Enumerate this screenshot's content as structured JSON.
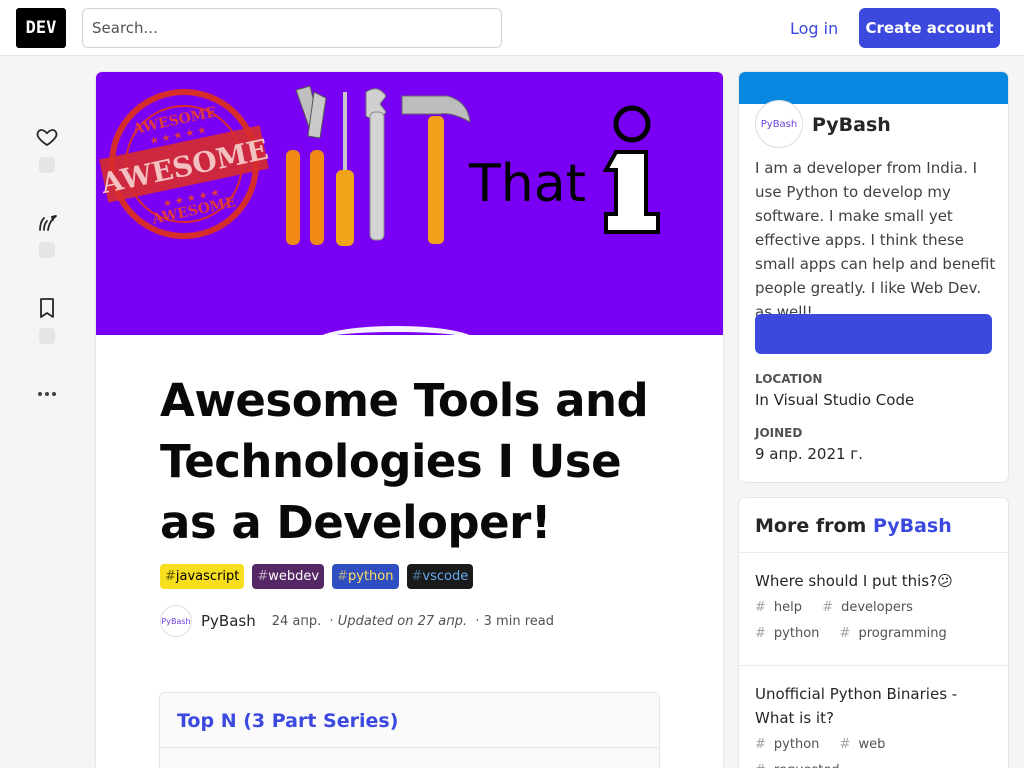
{
  "header": {
    "logo_text": "DEV",
    "search_placeholder": "Search...",
    "login_label": "Log in",
    "create_account_label": "Create account",
    "accent_color": "#3b49df"
  },
  "rail": {
    "items": [
      {
        "icon": "heart-icon"
      },
      {
        "icon": "unicorn-icon"
      },
      {
        "icon": "bookmark-icon"
      },
      {
        "icon": "more-dots-icon"
      }
    ]
  },
  "article": {
    "cover": {
      "background_color": "#7a00f5",
      "badge_text_top": "AWESOME",
      "badge_text_center": "AWESOME",
      "badge_text_bottom": "AWESOME",
      "word": "That"
    },
    "title": "Awesome Tools and Technologies I Use as a Developer!",
    "tags": [
      {
        "hash": "#",
        "name": "javascript",
        "bg": "#f7df1e",
        "fg": "#000000"
      },
      {
        "hash": "#",
        "name": "webdev",
        "bg": "#562765",
        "fg": "#ffffff"
      },
      {
        "hash": "#",
        "name": "python",
        "bg": "#2f4ec2",
        "fg": "#ffdf5b"
      },
      {
        "hash": "#",
        "name": "vscode",
        "bg": "#1a1a1a",
        "fg": "#65aaf0"
      }
    ],
    "author": {
      "avatar_text": "PyBash",
      "name": "PyBash",
      "date": "24 апр.",
      "updated": "Updated on 27 апр.",
      "read_time": "3 min read"
    },
    "series": {
      "title": "Top N (3 Part Series)"
    }
  },
  "profile": {
    "avatar_text": "PyBash",
    "name": "PyBash",
    "bio": "I am a developer from India. I use Python to develop my software. I make small yet effective apps. I think these small apps can help and benefit people greatly. I like Web Dev. as well!",
    "location_label": "LOCATION",
    "location_value": "In Visual Studio Code",
    "joined_label": "JOINED",
    "joined_value": "9 апр. 2021 г.",
    "band_color": "#0888e0"
  },
  "more_from": {
    "heading_prefix": "More from",
    "heading_link": "PyBash",
    "items": [
      {
        "title": "Where should I put this?😕",
        "tags": [
          "help",
          "developers",
          "python",
          "programming"
        ]
      },
      {
        "title": "Unofficial Python Binaries - What is it?",
        "tags": [
          "python",
          "web",
          "requested"
        ]
      }
    ]
  }
}
